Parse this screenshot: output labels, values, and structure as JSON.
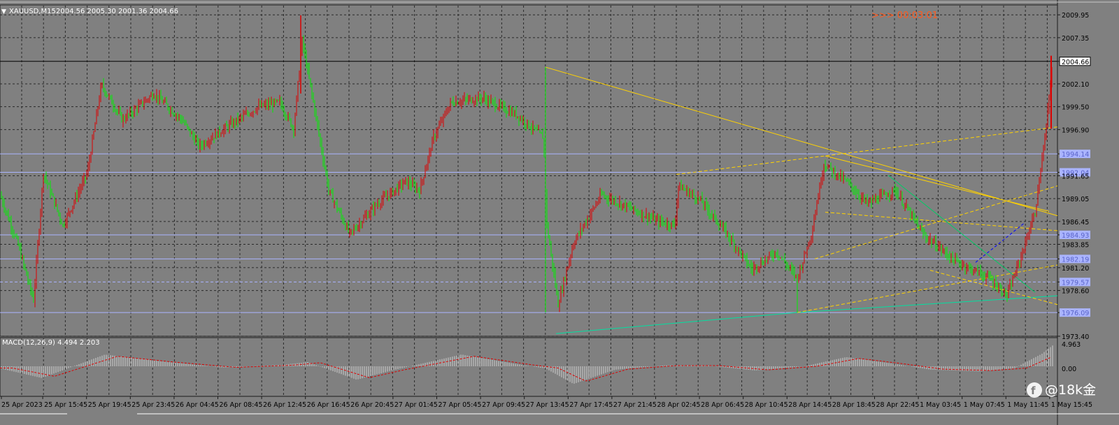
{
  "header": {
    "dropdown_icon": "triangle-down-icon",
    "symbol": "XAUUSD,M15",
    "ohlc": "2004.56 2005.30 2001.36 2004.66",
    "countdown": ">>> 00:03:01"
  },
  "macd": {
    "label": "MACD(12,26,9) 4.494 2.203",
    "ticks": [
      "4.963",
      "0.00"
    ]
  },
  "watermark": {
    "icon": "facebook-icon",
    "text": "@18k金"
  },
  "colors": {
    "background": "#808080",
    "grid": "#2a2a2a",
    "bull": "#dd0000",
    "bear": "#00ee00",
    "trendline": "#ffd200",
    "support": "#00e0a0",
    "hline": "#aab4ff",
    "price_box": "#ffffff",
    "countdown": "#ff5a1e",
    "macd_signal": "#dd0000",
    "macd_hist": "#d0d0d0"
  },
  "chart_data": {
    "type": "candlestick",
    "symbol": "XAUUSD",
    "timeframe": "M15",
    "current_price": 2004.66,
    "ylim": [
      1973.4,
      2011.0
    ],
    "y_ticks": [
      "2009.95",
      "2007.35",
      "2004.66",
      "2002.10",
      "1999.50",
      "1996.90",
      "1994.14",
      "1992.04",
      "1991.65",
      "1989.05",
      "1986.45",
      "1984.93",
      "1983.85",
      "1982.19",
      "1981.20",
      "1979.57",
      "1978.60",
      "1976.09",
      "1973.40"
    ],
    "highlighted_levels": [
      "1994.14",
      "1992.04",
      "1984.93",
      "1982.19",
      "1979.57",
      "1976.09"
    ],
    "x_ticks": [
      "25 Apr 2023",
      "25 Apr 15:45",
      "25 Apr 19:45",
      "25 Apr 23:45",
      "26 Apr 04:45",
      "26 Apr 08:45",
      "26 Apr 12:45",
      "26 Apr 16:45",
      "26 Apr 20:45",
      "27 Apr 01:45",
      "27 Apr 05:45",
      "27 Apr 09:45",
      "27 Apr 13:45",
      "27 Apr 17:45",
      "27 Apr 21:45",
      "28 Apr 02:45",
      "28 Apr 06:45",
      "28 Apr 10:45",
      "28 Apr 14:45",
      "28 Apr 18:45",
      "28 Apr 22:45",
      "1 May 03:45",
      "1 May 07:45",
      "1 May 11:45",
      "1 May 15:45"
    ],
    "close_path": [
      [
        0,
        1989.5
      ],
      [
        25,
        1984
      ],
      [
        48,
        1977.5
      ],
      [
        62,
        1992
      ],
      [
        90,
        1986
      ],
      [
        125,
        1992
      ],
      [
        145,
        2002
      ],
      [
        175,
        1998
      ],
      [
        220,
        2001
      ],
      [
        260,
        1998
      ],
      [
        285,
        1995
      ],
      [
        330,
        1997.5
      ],
      [
        370,
        1999.5
      ],
      [
        400,
        2000
      ],
      [
        420,
        1997
      ],
      [
        432,
        2007
      ],
      [
        448,
        2000
      ],
      [
        470,
        1990
      ],
      [
        500,
        1985
      ],
      [
        540,
        1988.5
      ],
      [
        580,
        1991
      ],
      [
        600,
        1990
      ],
      [
        620,
        1996
      ],
      [
        645,
        2000
      ],
      [
        690,
        2000.5
      ],
      [
        740,
        1998.5
      ],
      [
        777,
        1996
      ],
      [
        782,
        1986
      ],
      [
        798,
        1977
      ],
      [
        820,
        1984
      ],
      [
        860,
        1989.5
      ],
      [
        900,
        1988
      ],
      [
        940,
        1986.5
      ],
      [
        965,
        1986
      ],
      [
        970,
        1990.5
      ],
      [
        1000,
        1989
      ],
      [
        1040,
        1985
      ],
      [
        1075,
        1981
      ],
      [
        1110,
        1983
      ],
      [
        1140,
        1980
      ],
      [
        1160,
        1985
      ],
      [
        1178,
        1993
      ],
      [
        1210,
        1991
      ],
      [
        1240,
        1988.5
      ],
      [
        1280,
        1990
      ],
      [
        1320,
        1985
      ],
      [
        1365,
        1982
      ],
      [
        1390,
        1981
      ],
      [
        1415,
        1980
      ],
      [
        1440,
        1978
      ],
      [
        1460,
        1982.5
      ],
      [
        1480,
        1987.5
      ],
      [
        1495,
        1996.5
      ],
      [
        1505,
        2004.66
      ]
    ],
    "macd_path": [
      [
        0,
        -0.5
      ],
      [
        60,
        -2.8
      ],
      [
        150,
        2.8
      ],
      [
        230,
        1.2
      ],
      [
        320,
        -0.3
      ],
      [
        400,
        0.3
      ],
      [
        440,
        1
      ],
      [
        510,
        -3.2
      ],
      [
        560,
        -1
      ],
      [
        660,
        2.8
      ],
      [
        740,
        0.5
      ],
      [
        780,
        -0.5
      ],
      [
        820,
        -4.2
      ],
      [
        880,
        -0.8
      ],
      [
        950,
        0.2
      ],
      [
        1010,
        0.2
      ],
      [
        1080,
        -1
      ],
      [
        1150,
        0
      ],
      [
        1210,
        2.2
      ],
      [
        1270,
        0.8
      ],
      [
        1330,
        -0.8
      ],
      [
        1400,
        -1.2
      ],
      [
        1450,
        -0.5
      ],
      [
        1490,
        3
      ],
      [
        1505,
        4.963
      ]
    ]
  }
}
